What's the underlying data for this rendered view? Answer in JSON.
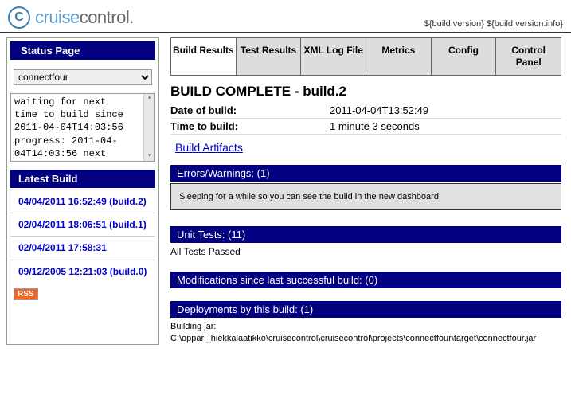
{
  "header": {
    "logo_main": "cruise",
    "logo_sub": "control.",
    "logo_letter": "C",
    "version_info": "${build.version} ${build.version.info}"
  },
  "sidebar": {
    "status_title": "Status Page",
    "project_selected": "connectfour",
    "log_text": "waiting for next\ntime to build since\n2011-04-04T14:03:56\nprogress: 2011-04-\n04T14:03:56 next",
    "latest_title": "Latest Build",
    "builds": [
      "04/04/2011 16:52:49 (build.2)",
      "02/04/2011 18:06:51 (build.1)",
      "02/04/2011 17:58:31",
      "09/12/2005 12:21:03 (build.0)"
    ],
    "rss_label": "RSS"
  },
  "tabs": [
    "Build Results",
    "Test Results",
    "XML Log File",
    "Metrics",
    "Config",
    "Control Panel"
  ],
  "build": {
    "title": "BUILD COMPLETE -  build.2",
    "date_label": "Date of build:",
    "date_value": "2011-04-04T13:52:49",
    "time_label": "Time to build:",
    "time_value": "1 minute 3 seconds",
    "artifacts_link": "Build Artifacts"
  },
  "sections": {
    "errors_title": "Errors/Warnings: (1)",
    "errors_body": "Sleeping for a while so you can see the build in the new dashboard",
    "tests_title": "Unit Tests: (11)",
    "tests_body": "All Tests Passed",
    "mods_title": "Modifications since last successful build:  (0)",
    "deploy_title": "Deployments by this build: (1)",
    "deploy_body": "Building jar:\nC:\\oppari_hiekkalaatikko\\cruisecontrol\\cruisecontrol\\projects\\connectfour\\target\\connectfour.jar"
  }
}
